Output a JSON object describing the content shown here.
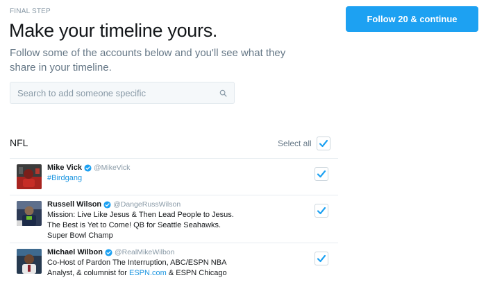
{
  "header": {
    "eyebrow": "FINAL STEP",
    "title": "Make your timeline yours.",
    "subtitle": "Follow some of the accounts below and you'll see what they share in your timeline."
  },
  "cta": {
    "label": "Follow 20 & continue",
    "color": "#1da1f2"
  },
  "search": {
    "placeholder": "Search to add someone specific",
    "value": ""
  },
  "section": {
    "title": "NFL",
    "select_all_label": "Select all",
    "select_all_checked": true
  },
  "accounts": [
    {
      "name": "Mike Vick",
      "handle": "@MikeVick",
      "bio": "#Birdgang",
      "verified": true,
      "checked": true
    },
    {
      "name": "Russell Wilson",
      "handle": "@DangeRussWilson",
      "bio": "Mission: Live Like Jesus & Then Lead People to Jesus. The Best is Yet to Come! QB for Seattle Seahawks. Super Bowl Champ",
      "verified": true,
      "checked": true
    },
    {
      "name": "Michael Wilbon",
      "handle": "@RealMikeWilbon",
      "bio_before_link": "Co-Host of Pardon The Interruption, ABC/ESPN NBA Analyst, & columnist for ",
      "bio_link": "ESPN.com",
      "bio_after_link": " & ESPN Chicago",
      "verified": true,
      "checked": true
    }
  ],
  "icons": {
    "search": "search-icon",
    "verified": "verified-badge-icon",
    "check": "checkmark-icon"
  },
  "colors": {
    "accent": "#1da1f2",
    "link": "#1b95e0",
    "muted": "#657786"
  }
}
